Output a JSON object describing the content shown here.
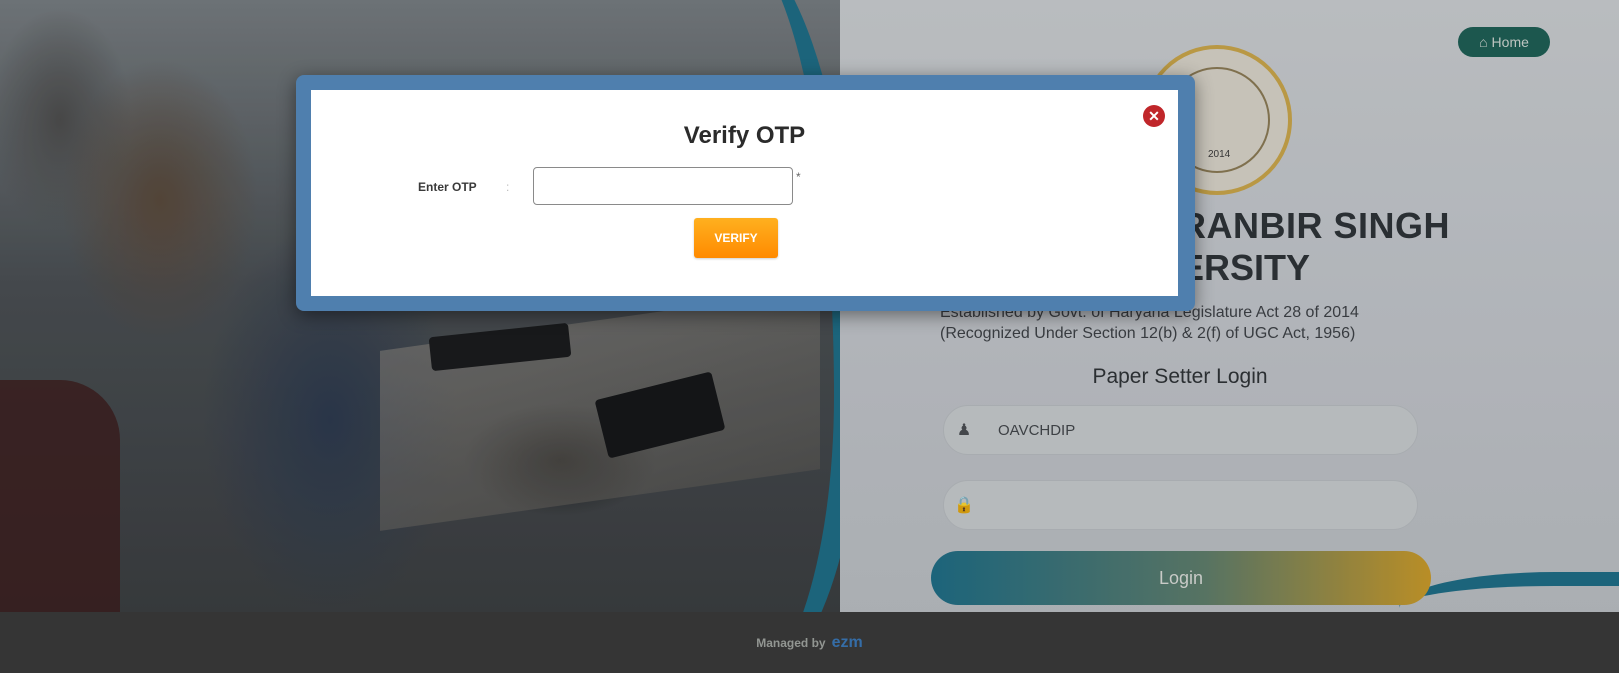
{
  "background": {
    "home_label": "Home",
    "university_title_line1": "RANBIR SINGH",
    "university_title_line2": "ERSITY",
    "seal_year": "2014",
    "established_line1": "Established by Govt. of Haryana Legislature Act 28 of 2014",
    "established_line2": "(Recognized Under Section 12(b) & 2(f) of UGC Act, 1956)",
    "login_heading": "Paper Setter Login",
    "username_value": "OAVCHDIP",
    "password_value": "",
    "login_button": "Login",
    "footer_text": "Managed by",
    "footer_logo": "ezm"
  },
  "modal": {
    "title": "Verify OTP",
    "otp_label": "Enter OTP",
    "otp_colon": ":",
    "otp_value": "",
    "required_mark": "*",
    "verify_button": "VERIFY",
    "close_symbol": "✕"
  },
  "colors": {
    "modal_frame": "#4f7fae",
    "verify_button": "#ff9a0a",
    "close_button": "#c0262a",
    "teal_accent": "#1f6d86"
  },
  "icons": {
    "home": "home-icon",
    "user": "user-icon",
    "lock": "lock-icon",
    "close": "close-icon"
  }
}
